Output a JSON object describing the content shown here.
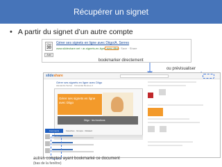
{
  "slide": {
    "title": "Récupérer un signet",
    "bullet_marker": "•",
    "bullet_text": "A partir du signet d’un autre compte"
  },
  "bookmark_card": {
    "title": "Gérer ses signets en ligne avec Diigo/A. Serres",
    "url": "www.slideshare.net › ar-signets-en-ligne-avec-diigo",
    "actions": "Save · Share",
    "date_month": "Oct",
    "date_day": "30",
    "add_label": "Add"
  },
  "annotations": {
    "bookmarker": "bookmarker directement",
    "preview": "ou prévisualiser",
    "accounts": "autres comptes ayant bookmarké ce document",
    "accounts_sub": "(bas de la fenêtre)"
  },
  "browser_view": {
    "logo_prefix": "slide",
    "logo_suffix": "share",
    "slide_title": "Gérer ses signets en ligne avec Diigo",
    "slide_meta": "Alexandre Serres · Université Rennes 2",
    "slide_inner_title": "Gérer ses signets en ligne avec Diigo",
    "slide_caption": "Diigo · les fonctions",
    "tab_active": "Comments",
    "tab_text": "Favorites · Groups · Related"
  },
  "colors": {
    "title_bar": "#4674b9",
    "highlight": "#4a7fe0",
    "accent_orange": "#f39a2b"
  }
}
